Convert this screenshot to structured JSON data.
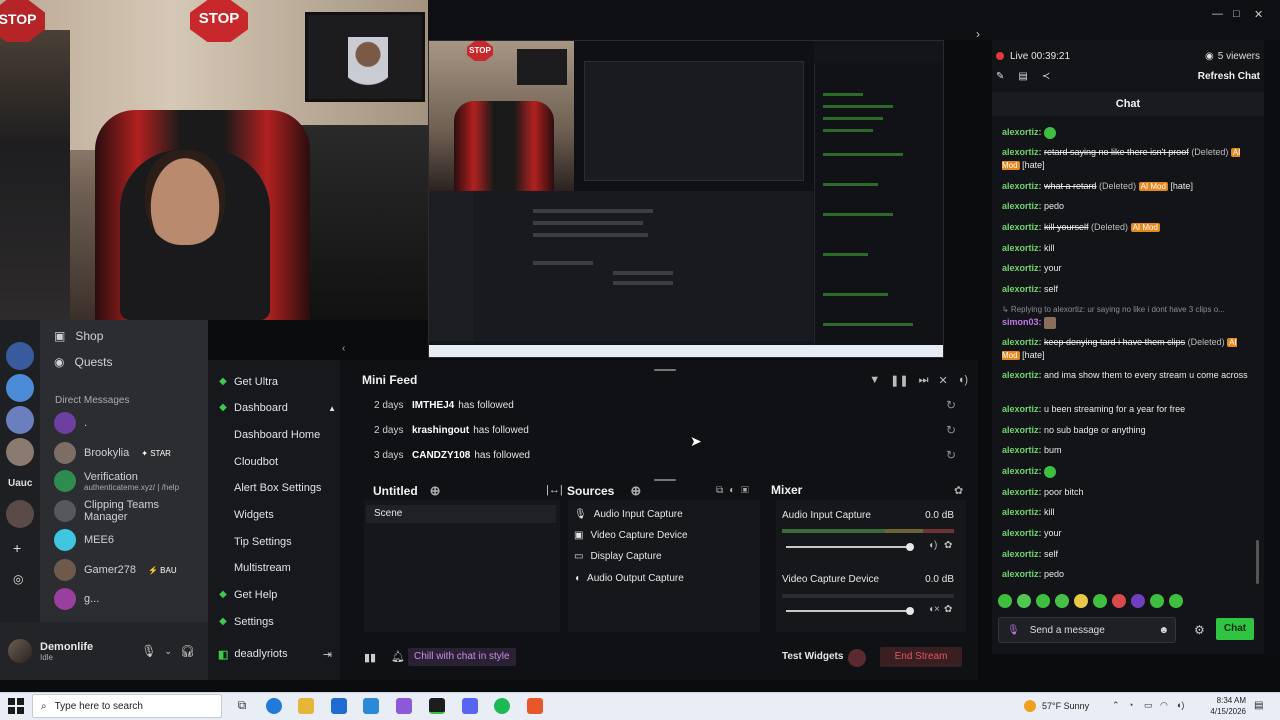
{
  "webcam": {
    "stop_sign": "STOP"
  },
  "window_controls": {
    "minimize": "—",
    "maximize": "□",
    "close": "✕"
  },
  "discord": {
    "top_items": [
      {
        "label": "Shop",
        "icon": "shop-icon"
      },
      {
        "label": "Quests",
        "icon": "quests-icon"
      }
    ],
    "dm_heading": "Direct Messages",
    "dms": [
      {
        "name": ".",
        "sub": "",
        "badge": ""
      },
      {
        "name": "Brookylia",
        "sub": "",
        "badge": "STAR"
      },
      {
        "name": "Verification",
        "sub": "authenticateme.xyz/ | /help",
        "badge": ""
      },
      {
        "name": "Clipping Teams Manager",
        "sub": "",
        "badge": ""
      },
      {
        "name": "MEE6",
        "sub": "",
        "badge": ""
      },
      {
        "name": "Gamer278",
        "sub": "",
        "badge": "BAU"
      },
      {
        "name": "g...",
        "sub": "",
        "badge": ""
      }
    ],
    "server_label": "Uauc",
    "user": {
      "name": "Demonlife",
      "status": "Idle"
    }
  },
  "streamlabs_nav": {
    "items": [
      {
        "label": "Get Ultra",
        "sub": false
      },
      {
        "label": "Dashboard",
        "sub": false
      },
      {
        "label": "Dashboard Home",
        "sub": true
      },
      {
        "label": "Cloudbot",
        "sub": true
      },
      {
        "label": "Alert Box Settings",
        "sub": true
      },
      {
        "label": "Widgets",
        "sub": true
      },
      {
        "label": "Tip Settings",
        "sub": true
      },
      {
        "label": "Multistream",
        "sub": true
      },
      {
        "label": "Get Help",
        "sub": false
      },
      {
        "label": "Settings",
        "sub": false
      }
    ],
    "account": "deadlyriots"
  },
  "mini_feed": {
    "title": "Mini Feed",
    "rows": [
      {
        "time": "2 days",
        "user": "IMTHEJ4",
        "action": "has followed"
      },
      {
        "time": "2 days",
        "user": "krashingout",
        "action": "has followed"
      },
      {
        "time": "3 days",
        "user": "CANDZY108",
        "action": "has followed"
      }
    ]
  },
  "scenes": {
    "title": "Untitled",
    "items": [
      "Scene"
    ]
  },
  "sources": {
    "title": "Sources",
    "items": [
      {
        "label": "Audio Input Capture",
        "icon": "microphone-icon"
      },
      {
        "label": "Video Capture Device",
        "icon": "camera-icon"
      },
      {
        "label": "Display Capture",
        "icon": "monitor-icon"
      },
      {
        "label": "Audio Output Capture",
        "icon": "speaker-icon"
      }
    ]
  },
  "mixer": {
    "title": "Mixer",
    "channels": [
      {
        "name": "Audio Input Capture",
        "level": "0.0 dB"
      },
      {
        "name": "Video Capture Device",
        "level": "0.0 dB"
      }
    ]
  },
  "bottom_bar": {
    "chill": "Chill with chat in style",
    "test_widgets": "Test Widgets",
    "end_stream": "End Stream"
  },
  "chat": {
    "live_label": "Live 00:39:21",
    "viewers": "5 viewers",
    "refresh": "Refresh Chat",
    "title": "Chat",
    "placeholder": "Send a message",
    "send": "Chat",
    "messages": [
      {
        "user": "alexortiz",
        "text": "",
        "emote": true
      },
      {
        "user": "alexortiz",
        "text": "retard saying no like there isn't proof",
        "deleted": true,
        "mod": true,
        "tag": "[hate]"
      },
      {
        "user": "alexortiz",
        "text": "what a retard",
        "deleted": true,
        "mod": true,
        "tag": "[hate]"
      },
      {
        "user": "alexortiz",
        "text": "pedo"
      },
      {
        "user": "alexortiz",
        "text": "kill yourself",
        "deleted": true,
        "mod": true,
        "tag": ""
      },
      {
        "user": "alexortiz",
        "text": "kill"
      },
      {
        "user": "alexortiz",
        "text": "your"
      },
      {
        "user": "alexortiz",
        "text": "self"
      },
      {
        "user": "simon03",
        "reply": "Replying to alexortiz: ur saying no like i dont have 3 clips o...",
        "text": ""
      },
      {
        "user": "alexortiz",
        "text": "keep denying tard i have them clips",
        "deleted": true,
        "mod": true,
        "tag": "[hate]"
      },
      {
        "user": "alexortiz",
        "text": "and ima show them to every stream u come across"
      },
      {
        "user": "alexortiz",
        "text": "u been streaming for a year for free"
      },
      {
        "user": "alexortiz",
        "text": "no sub badge or anything"
      },
      {
        "user": "alexortiz",
        "text": "bum"
      },
      {
        "user": "alexortiz",
        "text": "",
        "emote": true
      },
      {
        "user": "alexortiz",
        "text": "poor bitch"
      },
      {
        "user": "alexortiz",
        "text": "kill"
      },
      {
        "user": "alexortiz",
        "text": "your"
      },
      {
        "user": "alexortiz",
        "text": "self"
      },
      {
        "user": "alexortiz",
        "text": "pedo"
      }
    ],
    "deleted_label": "(Deleted)",
    "mod_label": "AI Mod",
    "colors": {
      "username": "#6fd46b",
      "send": "#2fc542",
      "mod": "#e6871e"
    }
  },
  "taskbar": {
    "search_placeholder": "Type here to search",
    "weather": "57°F  Sunny",
    "time": "8:34 AM",
    "date": "4/15/2026"
  }
}
